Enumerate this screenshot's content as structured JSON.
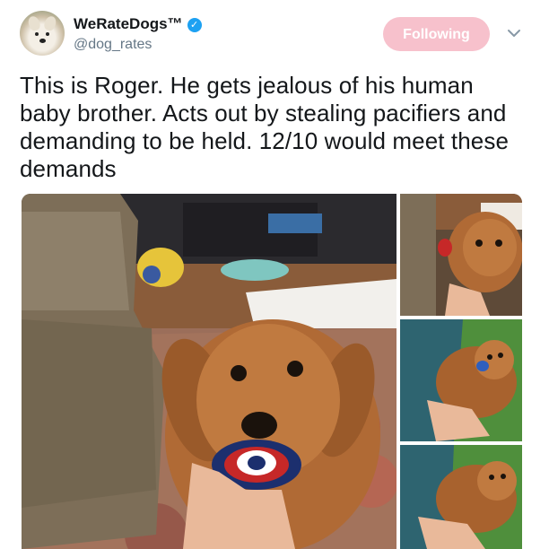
{
  "author": {
    "display_name": "WeRateDogs™",
    "handle": "@dog_rates",
    "verified_icon": "verified-check-icon",
    "avatar_icon": "dog-avatar"
  },
  "follow_button": {
    "label": "Following",
    "color": "#f7c1cc"
  },
  "menu": {
    "icon": "chevron-down-icon"
  },
  "tweet": {
    "text": "This is Roger. He gets jealous of his human baby brother. Acts out by stealing pacifiers and demanding to be held. 12/10 would meet these demands"
  },
  "media": {
    "photo_count": 4,
    "photos": [
      "main-photo",
      "thumbnail-1",
      "thumbnail-2",
      "thumbnail-3"
    ]
  },
  "colors": {
    "link_blue": "#1da1f2",
    "handle_gray": "#657786",
    "text": "#14171a"
  }
}
